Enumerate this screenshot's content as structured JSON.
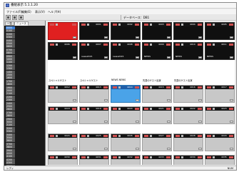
{
  "window": {
    "title": "番組表示 5.1.1.20"
  },
  "menu": [
    "ファイル(F)",
    "編集(E)",
    "表示(V)",
    "ヘルプ(H)"
  ],
  "toolbar": {
    "db_label": "データベース：DB1"
  },
  "left_panel": {
    "tabs": [
      "一覧",
      "ニュース"
    ],
    "rows": [
      "0000",
      "0100",
      "0200",
      "0300",
      "0400",
      "0500",
      "0600",
      "0700",
      "0800",
      "0900",
      "1000",
      "1100",
      "1200",
      "1300",
      "1400",
      "1500",
      "1600",
      "1700",
      "1800",
      "1900",
      "2000",
      "2100",
      "2200",
      "2300",
      "2400",
      "2500",
      "2600",
      "2700",
      "2800",
      "2900",
      "3000",
      "3100",
      "3200",
      "3300",
      "3400",
      "3500",
      "3600",
      "3700",
      "3800",
      "3900",
      "4000",
      "4100",
      "4200",
      "4300",
      "4500"
    ]
  },
  "group_labels": [
    "スペシャルゲスト",
    "スペシャルゲスト",
    "NEWS NEWS",
    "先週のゲスト出演",
    "先週のゲスト出演"
  ],
  "cell_rows": [
    [
      {
        "id": "",
        "style": "red",
        "text": ""
      },
      {
        "id": "4001",
        "style": "dark",
        "text": ""
      },
      {
        "id": "4002",
        "style": "dark",
        "text": ""
      },
      {
        "id": "4003",
        "style": "dark",
        "text": ""
      },
      {
        "id": "4004",
        "style": "dark",
        "text": ""
      },
      {
        "id": "4005",
        "style": "dark",
        "text": ""
      }
    ],
    [
      {
        "id": "4006",
        "style": "dark",
        "text": ""
      },
      {
        "id": "4007",
        "style": "dark",
        "text": "news2015"
      },
      {
        "id": "4008",
        "style": "dark",
        "text": "news2015"
      },
      {
        "id": "4009",
        "style": "dark",
        "text": "NEWS"
      },
      {
        "id": "4010",
        "style": "dark",
        "text": "NEWS"
      },
      {
        "id": "4011",
        "style": "dark",
        "text": "NEWS"
      }
    ],
    [
      {
        "id": "4012",
        "style": "gray",
        "text": ""
      },
      {
        "id": "4013",
        "style": "gray",
        "text": ""
      },
      {
        "id": "4014",
        "style": "blue",
        "text": ""
      },
      {
        "id": "4015",
        "style": "gray",
        "text": ""
      },
      {
        "id": "4016",
        "style": "gray",
        "text": ""
      },
      {
        "id": "4017",
        "style": "gray",
        "text": ""
      }
    ],
    [
      {
        "id": "4018",
        "style": "gray",
        "text": ""
      },
      {
        "id": "4019",
        "style": "gray",
        "text": ""
      },
      {
        "id": "4020",
        "style": "gray",
        "text": ""
      },
      {
        "id": "4021",
        "style": "gray",
        "text": ""
      },
      {
        "id": "4022",
        "style": "gray",
        "text": ""
      },
      {
        "id": "4023",
        "style": "gray",
        "text": ""
      }
    ],
    [
      {
        "id": "4024",
        "style": "gray",
        "text": ""
      },
      {
        "id": "4025",
        "style": "gray",
        "text": ""
      },
      {
        "id": "4026",
        "style": "gray",
        "text": ""
      },
      {
        "id": "4027",
        "style": "gray",
        "text": ""
      },
      {
        "id": "4028",
        "style": "gray",
        "text": ""
      },
      {
        "id": "4029",
        "style": "gray",
        "text": ""
      }
    ],
    [
      {
        "id": "4030",
        "style": "gray",
        "text": ""
      },
      {
        "id": "4031",
        "style": "gray",
        "text": ""
      },
      {
        "id": "4032",
        "style": "gray",
        "text": ""
      },
      {
        "id": "4033",
        "style": "gray",
        "text": ""
      },
      {
        "id": "4034",
        "style": "gray",
        "text": ""
      },
      {
        "id": "4035",
        "style": "gray",
        "text": ""
      }
    ]
  ],
  "status": {
    "left": "レディ",
    "right": "NUM"
  },
  "colors": {
    "accent_red": "#e02020",
    "selected_blue": "#4aa3e8",
    "panel_dark": "#1a1a1a"
  }
}
